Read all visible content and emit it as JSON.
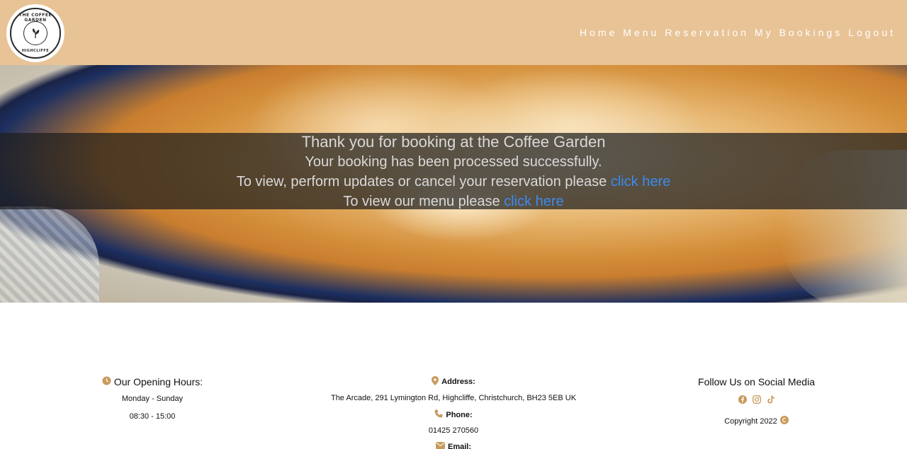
{
  "logo": {
    "top_text": "THE COFFEE GARDEN",
    "bottom_text": "HIGHCLIFFE"
  },
  "nav": {
    "items": [
      {
        "label": "Home"
      },
      {
        "label": "Menu"
      },
      {
        "label": "Reservation"
      },
      {
        "label": "My Bookings"
      },
      {
        "label": "Logout"
      }
    ]
  },
  "hero": {
    "line1": "Thank you for booking at the Coffee Garden",
    "line2": "Your booking has been processed successfully.",
    "line3_text": "To view, perform updates or cancel your reservation please ",
    "line3_link": "click here",
    "line4_text": "To view our menu please ",
    "line4_link": "click here"
  },
  "footer": {
    "hours": {
      "title": "Our Opening Hours:",
      "days": "Monday - Sunday",
      "time": "08:30 - 15:00",
      "icon": "clock-icon"
    },
    "contact": {
      "address_label": "Address:",
      "address": "The Arcade, 291 Lymington Rd, Highcliffe, Christchurch, BH23 5EB UK",
      "phone_label": "Phone:",
      "phone": "01425 270560",
      "email_label": "Email:"
    },
    "social": {
      "title": "Follow Us on Social Media",
      "icons": [
        "facebook-icon",
        "instagram-icon",
        "tiktok-icon"
      ],
      "copyright": "Copyright 2022"
    }
  },
  "colors": {
    "header_bg": "#e8c396",
    "link": "#3b8bf0",
    "footer_icon": "#c89a5c"
  }
}
